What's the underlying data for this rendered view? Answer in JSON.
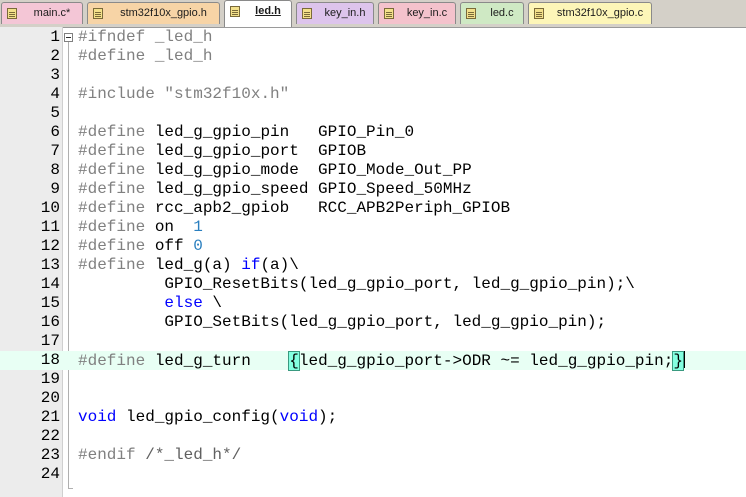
{
  "tabs": [
    {
      "label": "main.c*",
      "active": false,
      "color": "#f4c6d6"
    },
    {
      "label": "stm32f10x_gpio.h",
      "active": false,
      "color": "#f7d4a6"
    },
    {
      "label": "led.h",
      "active": true,
      "color": "#ffffff"
    },
    {
      "label": "key_in.h",
      "active": false,
      "color": "#ddc4ec"
    },
    {
      "label": "key_in.c",
      "active": false,
      "color": "#f4c2cc"
    },
    {
      "label": "led.c",
      "active": false,
      "color": "#cfe9c4"
    },
    {
      "label": "stm32f10x_gpio.c",
      "active": false,
      "color": "#fdf6b8"
    }
  ],
  "lines": [
    {
      "n": "1",
      "code": [
        {
          "t": "#ifndef _led_h",
          "c": "pp"
        }
      ]
    },
    {
      "n": "2",
      "code": [
        {
          "t": "#define _led_h",
          "c": "pp"
        }
      ]
    },
    {
      "n": "3",
      "code": []
    },
    {
      "n": "4",
      "code": [
        {
          "t": "#include ",
          "c": "pp"
        },
        {
          "t": "\"stm32f10x.h\"",
          "c": "str"
        }
      ]
    },
    {
      "n": "5",
      "code": []
    },
    {
      "n": "6",
      "code": [
        {
          "t": "#define",
          "c": "pp"
        },
        {
          "t": " led_g_gpio_pin   GPIO_Pin_0",
          "c": ""
        }
      ]
    },
    {
      "n": "7",
      "code": [
        {
          "t": "#define",
          "c": "pp"
        },
        {
          "t": " led_g_gpio_port  GPIOB",
          "c": ""
        }
      ]
    },
    {
      "n": "8",
      "code": [
        {
          "t": "#define",
          "c": "pp"
        },
        {
          "t": " led_g_gpio_mode  GPIO_Mode_Out_PP",
          "c": ""
        }
      ]
    },
    {
      "n": "9",
      "code": [
        {
          "t": "#define",
          "c": "pp"
        },
        {
          "t": " led_g_gpio_speed GPIO_Speed_50MHz",
          "c": ""
        }
      ]
    },
    {
      "n": "10",
      "code": [
        {
          "t": "#define",
          "c": "pp"
        },
        {
          "t": " rcc_apb2_gpiob   RCC_APB2Periph_GPIOB",
          "c": ""
        }
      ]
    },
    {
      "n": "11",
      "code": [
        {
          "t": "#define",
          "c": "pp"
        },
        {
          "t": " on  ",
          "c": ""
        },
        {
          "t": "1",
          "c": "num"
        }
      ]
    },
    {
      "n": "12",
      "code": [
        {
          "t": "#define",
          "c": "pp"
        },
        {
          "t": " off ",
          "c": ""
        },
        {
          "t": "0",
          "c": "num"
        }
      ]
    },
    {
      "n": "13",
      "code": [
        {
          "t": "#define",
          "c": "pp"
        },
        {
          "t": " led_g(a) ",
          "c": ""
        },
        {
          "t": "if",
          "c": "kw"
        },
        {
          "t": "(a)\\",
          "c": ""
        }
      ]
    },
    {
      "n": "14",
      "code": [
        {
          "t": "         GPIO_ResetBits(led_g_gpio_port, led_g_gpio_pin);\\",
          "c": ""
        }
      ]
    },
    {
      "n": "15",
      "code": [
        {
          "t": "         ",
          "c": ""
        },
        {
          "t": "else",
          "c": "kw"
        },
        {
          "t": " \\",
          "c": ""
        }
      ]
    },
    {
      "n": "16",
      "code": [
        {
          "t": "         GPIO_SetBits(led_g_gpio_port, led_g_gpio_pin);",
          "c": ""
        }
      ]
    },
    {
      "n": "17",
      "code": []
    },
    {
      "n": "18",
      "code": [
        {
          "t": "#define",
          "c": "pp"
        },
        {
          "t": " led_g_turn    ",
          "c": ""
        },
        {
          "t": "{",
          "c": "brace"
        },
        {
          "t": "led_g_gpio_port->ODR ~= led_g_gpio_pin;",
          "c": ""
        },
        {
          "t": "}",
          "c": "brace"
        },
        {
          "t": "",
          "c": "caret"
        }
      ],
      "highlight": true
    },
    {
      "n": "19",
      "code": []
    },
    {
      "n": "20",
      "code": []
    },
    {
      "n": "21",
      "code": [
        {
          "t": "void",
          "c": "kw"
        },
        {
          "t": " led_gpio_config(",
          "c": ""
        },
        {
          "t": "void",
          "c": "kw"
        },
        {
          "t": ");",
          "c": ""
        }
      ]
    },
    {
      "n": "22",
      "code": []
    },
    {
      "n": "23",
      "code": [
        {
          "t": "#endif",
          "c": "pp"
        },
        {
          "t": " ",
          "c": ""
        },
        {
          "t": "/*_led_h*/",
          "c": "cmt"
        }
      ]
    },
    {
      "n": "24",
      "code": []
    }
  ]
}
